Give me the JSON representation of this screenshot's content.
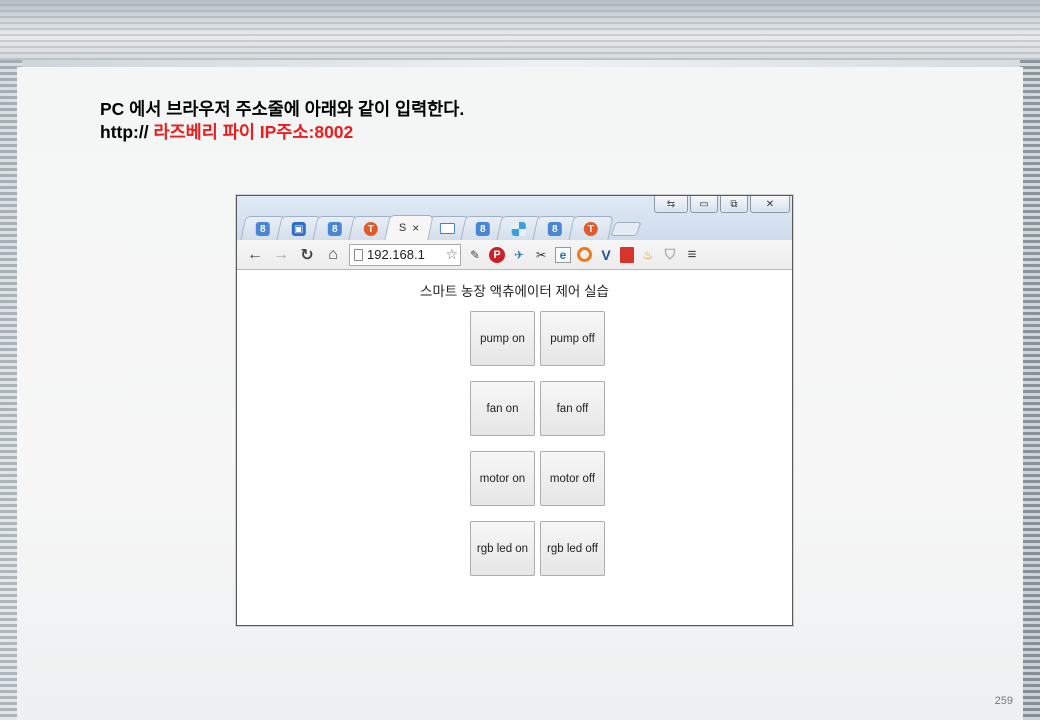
{
  "slide": {
    "heading_line1": "PC 에서 브라우저 주소줄에 아래와 같이 입력한다.",
    "heading_line2_prefix": "http:// ",
    "heading_line2_red": "라즈베리 파이 IP주소:8002",
    "page_number": "259"
  },
  "browser": {
    "active_tab_label": "S",
    "tab_close_glyph": "×",
    "url": "192.168.1",
    "window_controls": {
      "minimize": "▭",
      "restore": "⧉",
      "close": "✕"
    },
    "tabs": [
      {
        "icon": "google-icon",
        "glyph": "8"
      },
      {
        "icon": "blue-app-icon",
        "glyph": "▣"
      },
      {
        "icon": "google-icon",
        "glyph": "8"
      },
      {
        "icon": "orange-app-icon",
        "glyph": "T"
      },
      {
        "icon": "mail-icon",
        "glyph": ""
      },
      {
        "icon": "google-icon",
        "glyph": "8"
      },
      {
        "icon": "grid-app-icon",
        "glyph": ""
      },
      {
        "icon": "google-icon",
        "glyph": "8"
      },
      {
        "icon": "orange-app-icon",
        "glyph": "T"
      }
    ]
  },
  "page": {
    "title": "스마트 농장 액츄에이터 제어 실습",
    "buttons": [
      {
        "label": "pump on"
      },
      {
        "label": "pump off"
      },
      {
        "label": "fan on"
      },
      {
        "label": "fan off"
      },
      {
        "label": "motor on"
      },
      {
        "label": "motor off"
      },
      {
        "label": "rgb led on"
      },
      {
        "label": "rgb led off"
      }
    ]
  },
  "colors": {
    "highlight_red": "#ee1c1c",
    "pinterest_red": "#cb2027",
    "tab_blue": "#4a86d6"
  }
}
